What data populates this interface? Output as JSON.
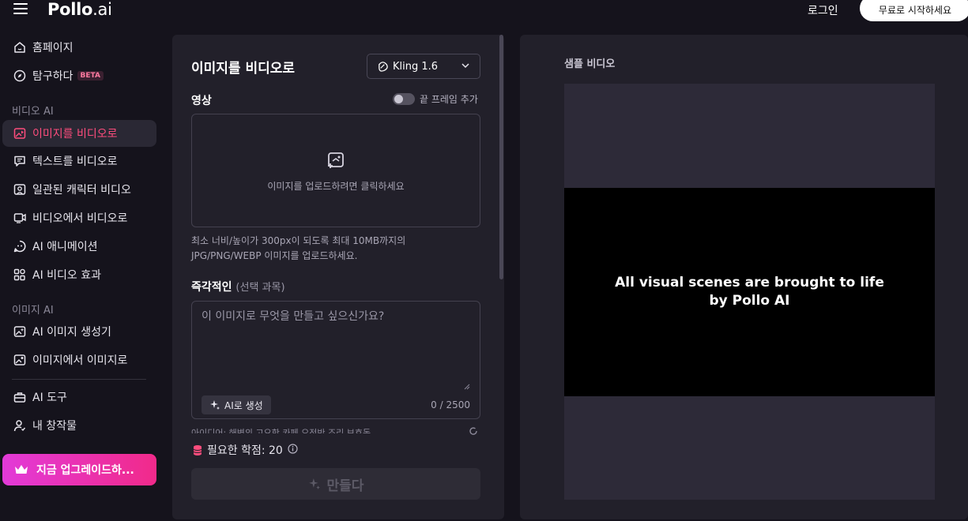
{
  "header": {
    "logo_main": "Pollo",
    "logo_suffix": ".ai",
    "login": "로그인",
    "start_free": "무료로 시작하세요"
  },
  "sidebar": {
    "home": "홈페이지",
    "explore": "탐구하다",
    "beta": "BETA",
    "section_video": "비디오 AI",
    "image_to_video": "이미지를 비디오로",
    "text_to_video": "텍스트를 비디오로",
    "consistent_character": "일관된 캐릭터 비디오",
    "video_to_video": "비디오에서 비디오로",
    "ai_animation": "AI 애니메이션",
    "ai_video_effects": "AI 비디오 효과",
    "section_image": "이미지 AI",
    "ai_image_generator": "AI 이미지 생성기",
    "image_to_image": "이미지에서 이미지로",
    "ai_tools": "AI 도구",
    "my_creations": "내 창작물",
    "upgrade": "지금 업그레이드하..."
  },
  "panel": {
    "title": "이미지를 비디오로",
    "model": "Kling 1.6",
    "video_label": "영상",
    "end_frame_label": "끝 프레임 추가",
    "end_frame_on": false,
    "upload_text": "이미지를 업로드하려면 클릭하세요",
    "hint_line1": "최소 너비/높이가 300px이 되도록 최대 10MB까지의",
    "hint_line2": "JPG/PNG/WEBP 이미지를 업로드하세요.",
    "prompt_label": "즉각적인",
    "prompt_optional": "(선택 과목)",
    "prompt_placeholder": "이 이미지로 무엇을 만들고 싶으신가요?",
    "ai_generate": "AI로 생성",
    "counter": "0 / 2500",
    "ideas": "아이디어:   해변의 고요한   카페 오전반   조리 보호독",
    "credits": "필요한 학점: 20",
    "create": "만들다"
  },
  "right": {
    "sample_label": "샘플 비디오",
    "video_line1": "All visual scenes are brought to life",
    "video_line2": "by Pollo AI"
  },
  "colors": {
    "accent": "#ff4d7d",
    "upgrade_gradient": [
      "#e23ad8",
      "#f12a8a"
    ],
    "panel_bg": "#22202a",
    "page_bg": "#15131c"
  }
}
